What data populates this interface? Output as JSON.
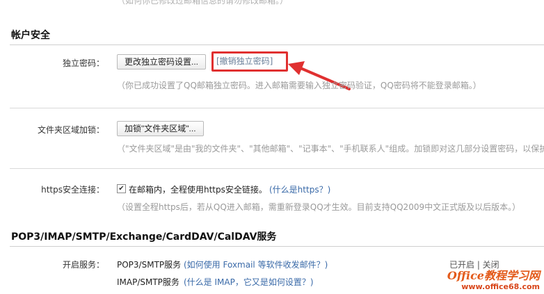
{
  "top": {
    "partial_hint": "（如何你已修改过邮箱信息的请勿修改邮箱。）"
  },
  "account_security": {
    "title": "帐户安全",
    "independent_password": {
      "label": "独立密码：",
      "change_button": "更改独立密码设置...",
      "revoke_link": "[撤销独立密码]",
      "hint": "（你已成功设置了QQ邮箱独立密码。进入邮箱需要输入独立密码验证，QQ密码将不能登录邮箱。）"
    },
    "folder_lock": {
      "label": "文件夹区域加锁：",
      "button": "加锁\"文件夹区域\"...",
      "hint": "（\"文件夹区域\"是由\"我的文件夹\"、\"其他邮箱\"、\"记事本\"、\"手机联系人\"组成。加锁即对这几部分设置密码，以保护"
    },
    "https": {
      "label": "https安全连接：",
      "checkbox_text": "在邮箱内，全程使用https安全链接。",
      "link": "(什么是https？)",
      "hint": "（设置全程https后，若从QQ进入邮箱，需重新登录QQ才生效。目前支持QQ2009中文正式版及以后版本。）"
    }
  },
  "pop3": {
    "title": "POP3/IMAP/SMTP/Exchange/CardDAV/CalDAV服务",
    "enable_label": "开启服务：",
    "rows": [
      {
        "name": "POP3/SMTP服务",
        "help": "(如何使用 Foxmail 等软件收发邮件？)",
        "status": "已开启 | 关闭"
      },
      {
        "name": "IMAP/SMTP服务",
        "help": "(什么是 IMAP，它又是如何设置？)"
      }
    ]
  },
  "watermark": {
    "line1": "Office教程学习网",
    "line2": "www.office68.com"
  },
  "colors": {
    "annotation_red": "#e03030",
    "link_blue": "#3a6aa8",
    "hint_gray": "#9a9a9a"
  }
}
